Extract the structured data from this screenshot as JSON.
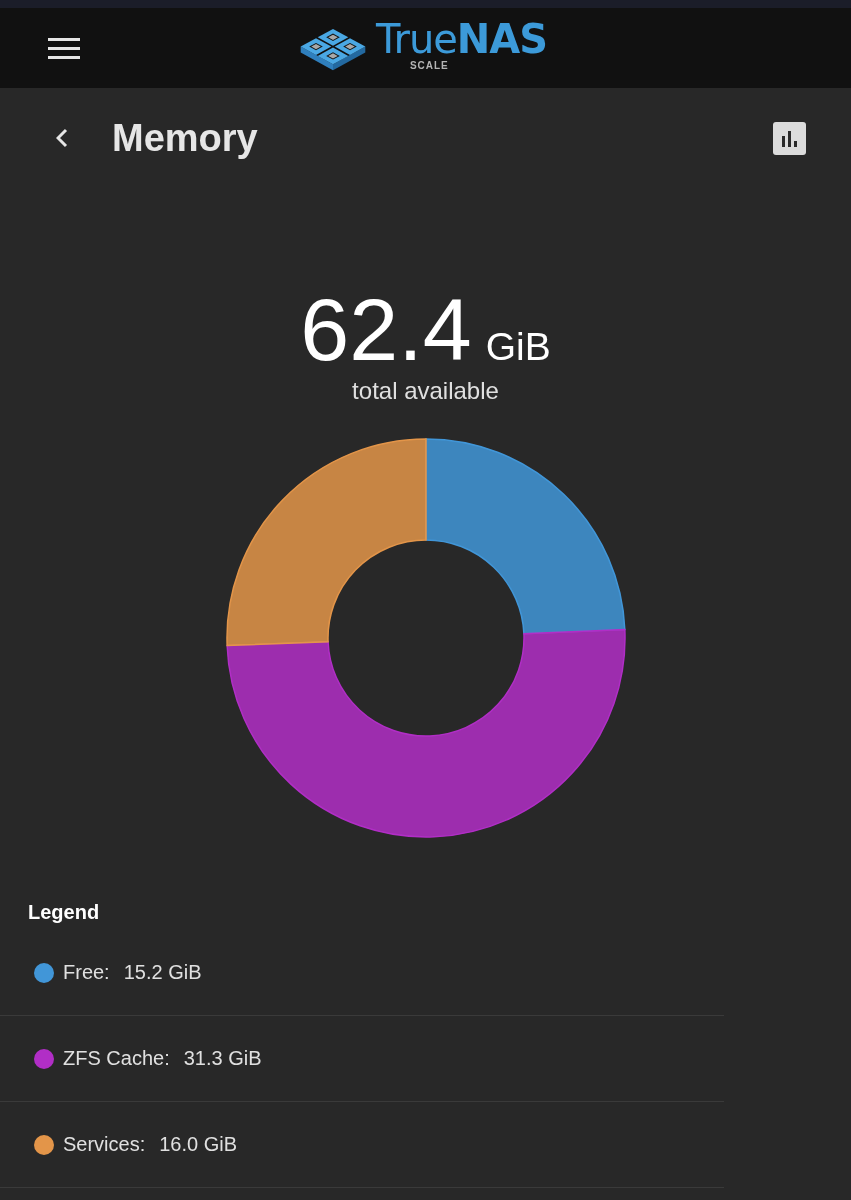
{
  "header": {
    "logo": {
      "name": "True**NAS**",
      "edition": "SCALE"
    }
  },
  "page": {
    "title": "Memory"
  },
  "summary": {
    "value": "62.4",
    "unit": "GiB",
    "caption": "total available"
  },
  "chart": {
    "chart_data": {
      "type": "donut",
      "values": [
        24.32,
        50.08,
        25.6
      ]
    }
  },
  "legend": {
    "title": "Legend",
    "items": [
      {
        "label": "Free:",
        "value": "15.2 GiB",
        "color": "#4196d8"
      },
      {
        "label": "ZFS Cache:",
        "value": "31.3 GiB",
        "color": "#b12ec6"
      },
      {
        "label": "Services:",
        "value": "16.0 GiB",
        "color": "#e39549"
      }
    ]
  }
}
